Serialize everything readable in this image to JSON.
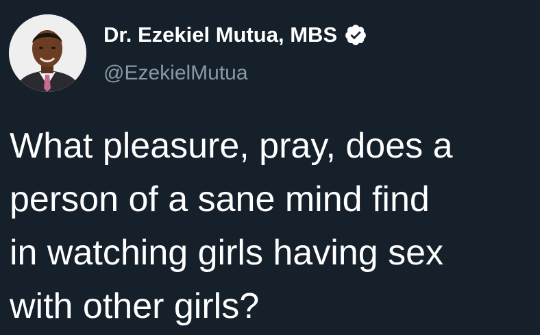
{
  "author": {
    "display_name": "Dr. Ezekiel Mutua, MBS",
    "handle": "@EzekielMutua",
    "verified": true,
    "avatar_icon": "profile-photo"
  },
  "tweet": {
    "lines": [
      "What pleasure, pray, does a",
      "person of a sane mind find",
      "in watching girls having sex",
      "with other girls?"
    ]
  },
  "colors": {
    "background": "#15202b",
    "text": "#ffffff",
    "secondary_text": "#8899a6",
    "verified_badge": "#ffffff"
  }
}
